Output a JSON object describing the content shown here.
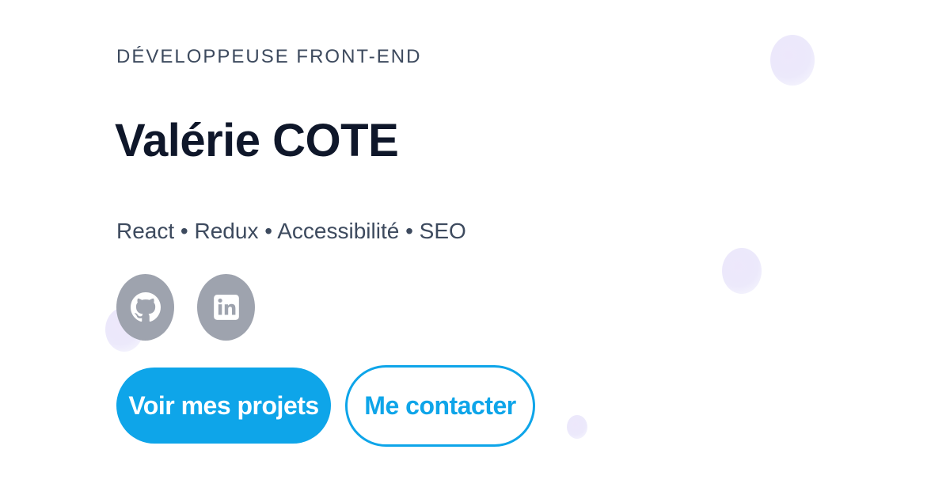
{
  "hero": {
    "eyebrow": "DÉVELOPPEUSE FRONT-END",
    "name": "Valérie COTE",
    "skills": "React • Redux • Accessibilité • SEO"
  },
  "socials": [
    {
      "icon": "github-icon"
    },
    {
      "icon": "linkedin-icon"
    }
  ],
  "actions": {
    "primary_label": "Voir mes projets",
    "secondary_label": "Me contacter"
  },
  "colors": {
    "accent": "#0ea5e9",
    "heading": "#0f172a",
    "text": "#3d4a5e",
    "icon_bg": "#9ea3ae",
    "bubble": "#ece9fb"
  }
}
